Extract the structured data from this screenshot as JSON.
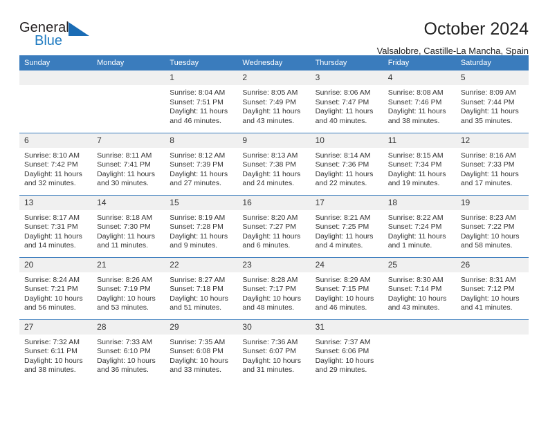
{
  "brand": {
    "name_part1": "General",
    "name_part2": "Blue",
    "triangle_color": "#1a6cb5",
    "blue_color": "#1f7bc1"
  },
  "header": {
    "title": "October 2024",
    "subtitle": "Valsalobre, Castille-La Mancha, Spain"
  },
  "calendar": {
    "header_bg": "#3a7cbd",
    "daynum_bg": "#f0f0f0",
    "weekday_headers": [
      "Sunday",
      "Monday",
      "Tuesday",
      "Wednesday",
      "Thursday",
      "Friday",
      "Saturday"
    ],
    "weeks": [
      [
        {
          "day": "",
          "empty": true
        },
        {
          "day": "",
          "empty": true
        },
        {
          "day": "1",
          "sunrise": "Sunrise: 8:04 AM",
          "sunset": "Sunset: 7:51 PM",
          "daylight": "Daylight: 11 hours and 46 minutes."
        },
        {
          "day": "2",
          "sunrise": "Sunrise: 8:05 AM",
          "sunset": "Sunset: 7:49 PM",
          "daylight": "Daylight: 11 hours and 43 minutes."
        },
        {
          "day": "3",
          "sunrise": "Sunrise: 8:06 AM",
          "sunset": "Sunset: 7:47 PM",
          "daylight": "Daylight: 11 hours and 40 minutes."
        },
        {
          "day": "4",
          "sunrise": "Sunrise: 8:08 AM",
          "sunset": "Sunset: 7:46 PM",
          "daylight": "Daylight: 11 hours and 38 minutes."
        },
        {
          "day": "5",
          "sunrise": "Sunrise: 8:09 AM",
          "sunset": "Sunset: 7:44 PM",
          "daylight": "Daylight: 11 hours and 35 minutes."
        }
      ],
      [
        {
          "day": "6",
          "sunrise": "Sunrise: 8:10 AM",
          "sunset": "Sunset: 7:42 PM",
          "daylight": "Daylight: 11 hours and 32 minutes."
        },
        {
          "day": "7",
          "sunrise": "Sunrise: 8:11 AM",
          "sunset": "Sunset: 7:41 PM",
          "daylight": "Daylight: 11 hours and 30 minutes."
        },
        {
          "day": "8",
          "sunrise": "Sunrise: 8:12 AM",
          "sunset": "Sunset: 7:39 PM",
          "daylight": "Daylight: 11 hours and 27 minutes."
        },
        {
          "day": "9",
          "sunrise": "Sunrise: 8:13 AM",
          "sunset": "Sunset: 7:38 PM",
          "daylight": "Daylight: 11 hours and 24 minutes."
        },
        {
          "day": "10",
          "sunrise": "Sunrise: 8:14 AM",
          "sunset": "Sunset: 7:36 PM",
          "daylight": "Daylight: 11 hours and 22 minutes."
        },
        {
          "day": "11",
          "sunrise": "Sunrise: 8:15 AM",
          "sunset": "Sunset: 7:34 PM",
          "daylight": "Daylight: 11 hours and 19 minutes."
        },
        {
          "day": "12",
          "sunrise": "Sunrise: 8:16 AM",
          "sunset": "Sunset: 7:33 PM",
          "daylight": "Daylight: 11 hours and 17 minutes."
        }
      ],
      [
        {
          "day": "13",
          "sunrise": "Sunrise: 8:17 AM",
          "sunset": "Sunset: 7:31 PM",
          "daylight": "Daylight: 11 hours and 14 minutes."
        },
        {
          "day": "14",
          "sunrise": "Sunrise: 8:18 AM",
          "sunset": "Sunset: 7:30 PM",
          "daylight": "Daylight: 11 hours and 11 minutes."
        },
        {
          "day": "15",
          "sunrise": "Sunrise: 8:19 AM",
          "sunset": "Sunset: 7:28 PM",
          "daylight": "Daylight: 11 hours and 9 minutes."
        },
        {
          "day": "16",
          "sunrise": "Sunrise: 8:20 AM",
          "sunset": "Sunset: 7:27 PM",
          "daylight": "Daylight: 11 hours and 6 minutes."
        },
        {
          "day": "17",
          "sunrise": "Sunrise: 8:21 AM",
          "sunset": "Sunset: 7:25 PM",
          "daylight": "Daylight: 11 hours and 4 minutes."
        },
        {
          "day": "18",
          "sunrise": "Sunrise: 8:22 AM",
          "sunset": "Sunset: 7:24 PM",
          "daylight": "Daylight: 11 hours and 1 minute."
        },
        {
          "day": "19",
          "sunrise": "Sunrise: 8:23 AM",
          "sunset": "Sunset: 7:22 PM",
          "daylight": "Daylight: 10 hours and 58 minutes."
        }
      ],
      [
        {
          "day": "20",
          "sunrise": "Sunrise: 8:24 AM",
          "sunset": "Sunset: 7:21 PM",
          "daylight": "Daylight: 10 hours and 56 minutes."
        },
        {
          "day": "21",
          "sunrise": "Sunrise: 8:26 AM",
          "sunset": "Sunset: 7:19 PM",
          "daylight": "Daylight: 10 hours and 53 minutes."
        },
        {
          "day": "22",
          "sunrise": "Sunrise: 8:27 AM",
          "sunset": "Sunset: 7:18 PM",
          "daylight": "Daylight: 10 hours and 51 minutes."
        },
        {
          "day": "23",
          "sunrise": "Sunrise: 8:28 AM",
          "sunset": "Sunset: 7:17 PM",
          "daylight": "Daylight: 10 hours and 48 minutes."
        },
        {
          "day": "24",
          "sunrise": "Sunrise: 8:29 AM",
          "sunset": "Sunset: 7:15 PM",
          "daylight": "Daylight: 10 hours and 46 minutes."
        },
        {
          "day": "25",
          "sunrise": "Sunrise: 8:30 AM",
          "sunset": "Sunset: 7:14 PM",
          "daylight": "Daylight: 10 hours and 43 minutes."
        },
        {
          "day": "26",
          "sunrise": "Sunrise: 8:31 AM",
          "sunset": "Sunset: 7:12 PM",
          "daylight": "Daylight: 10 hours and 41 minutes."
        }
      ],
      [
        {
          "day": "27",
          "sunrise": "Sunrise: 7:32 AM",
          "sunset": "Sunset: 6:11 PM",
          "daylight": "Daylight: 10 hours and 38 minutes."
        },
        {
          "day": "28",
          "sunrise": "Sunrise: 7:33 AM",
          "sunset": "Sunset: 6:10 PM",
          "daylight": "Daylight: 10 hours and 36 minutes."
        },
        {
          "day": "29",
          "sunrise": "Sunrise: 7:35 AM",
          "sunset": "Sunset: 6:08 PM",
          "daylight": "Daylight: 10 hours and 33 minutes."
        },
        {
          "day": "30",
          "sunrise": "Sunrise: 7:36 AM",
          "sunset": "Sunset: 6:07 PM",
          "daylight": "Daylight: 10 hours and 31 minutes."
        },
        {
          "day": "31",
          "sunrise": "Sunrise: 7:37 AM",
          "sunset": "Sunset: 6:06 PM",
          "daylight": "Daylight: 10 hours and 29 minutes."
        },
        {
          "day": "",
          "empty": true
        },
        {
          "day": "",
          "empty": true
        }
      ]
    ]
  }
}
